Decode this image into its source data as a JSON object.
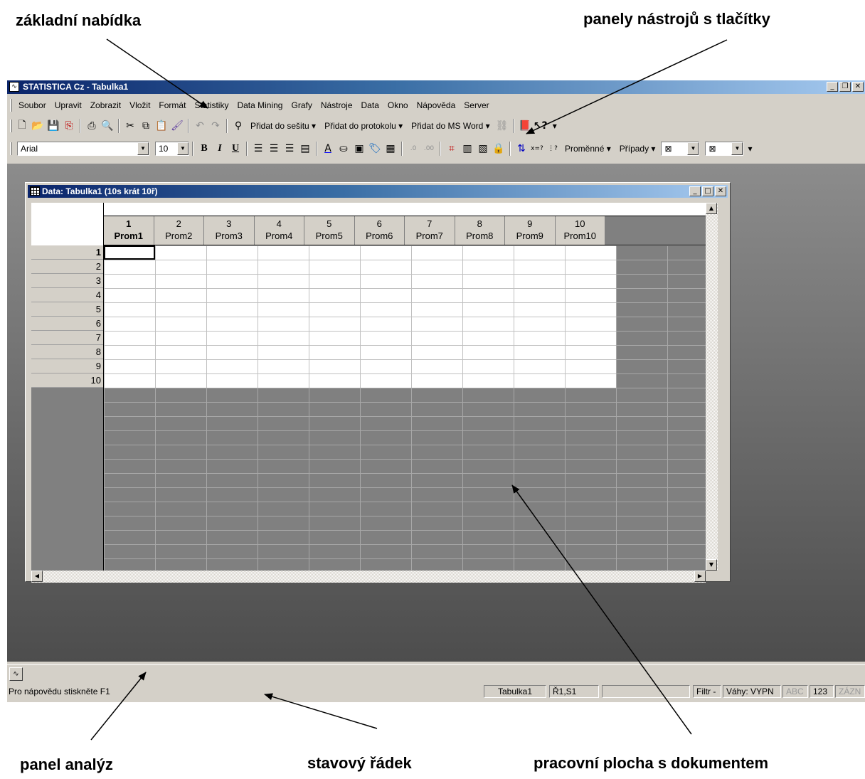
{
  "callouts": {
    "main_menu": "základní nabídka",
    "toolbars": "panely nástrojů s tlačítky",
    "analysis_bar": "panel analýz",
    "status_line": "stavový řádek",
    "workspace": "pracovní plocha s dokumentem"
  },
  "app": {
    "title": "STATISTICA Cz - Tabulka1"
  },
  "menu": [
    "Soubor",
    "Upravit",
    "Zobrazit",
    "Vložit",
    "Formát",
    "Statistiky",
    "Data Mining",
    "Grafy",
    "Nástroje",
    "Data",
    "Okno",
    "Nápověda",
    "Server"
  ],
  "toolbar1": {
    "add_workbook": "Přidat do sešitu",
    "add_report": "Přidat do protokolu",
    "add_word": "Přidat do MS Word"
  },
  "toolbar2": {
    "font": "Arial",
    "font_size": "10",
    "variables": "Proměnné",
    "cases": "Případy"
  },
  "document": {
    "title": "Data: Tabulka1 (10s krát 10ř)",
    "columns": [
      {
        "num": "1",
        "name": "Prom1"
      },
      {
        "num": "2",
        "name": "Prom2"
      },
      {
        "num": "3",
        "name": "Prom3"
      },
      {
        "num": "4",
        "name": "Prom4"
      },
      {
        "num": "5",
        "name": "Prom5"
      },
      {
        "num": "6",
        "name": "Prom6"
      },
      {
        "num": "7",
        "name": "Prom7"
      },
      {
        "num": "8",
        "name": "Prom8"
      },
      {
        "num": "9",
        "name": "Prom9"
      },
      {
        "num": "10",
        "name": "Prom10"
      }
    ],
    "rows": [
      "1",
      "2",
      "3",
      "4",
      "5",
      "6",
      "7",
      "8",
      "9",
      "10"
    ]
  },
  "status": {
    "help": "Pro nápovědu stiskněte F1",
    "sheet": "Tabulka1",
    "position": "Ř1,S1",
    "filter": "Filtr -",
    "weights": "Váhy: VYPN",
    "abc": "ABC",
    "num": "123",
    "record": "ZÁZN"
  }
}
